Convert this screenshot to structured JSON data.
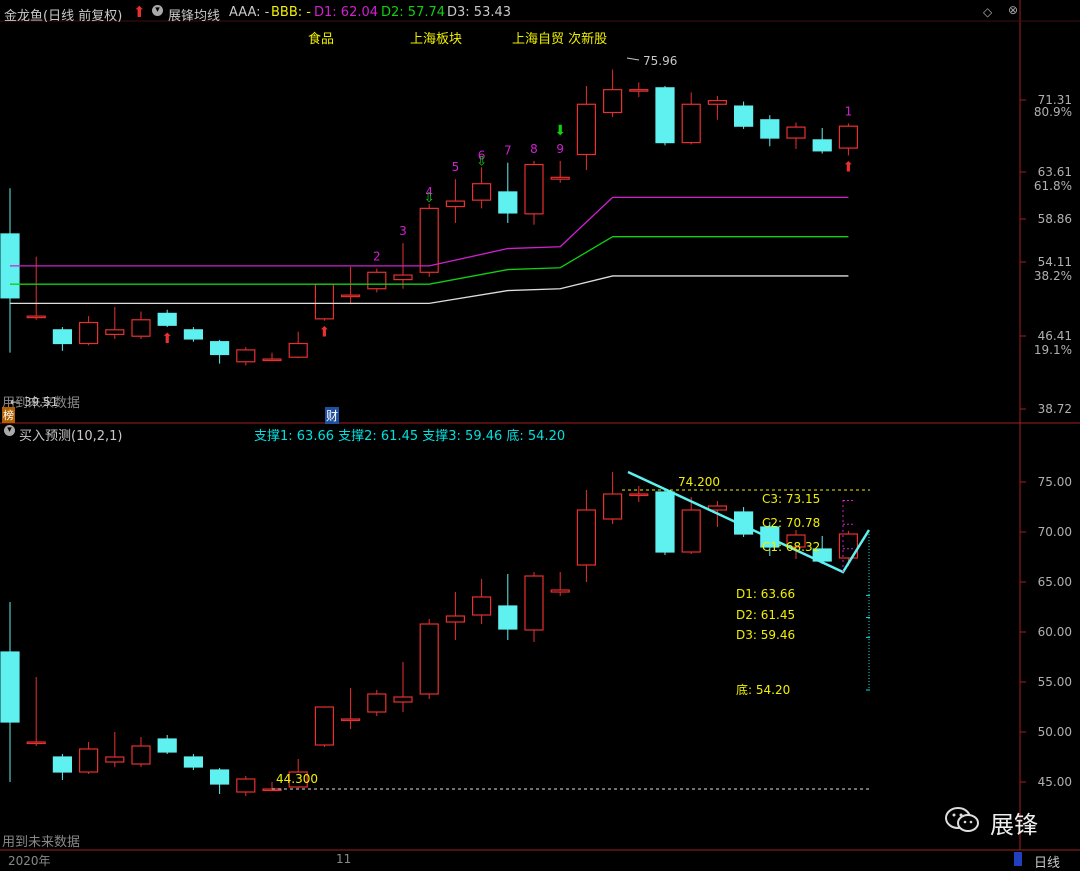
{
  "colors": {
    "up": "#e83030",
    "down": "#5ff0f0",
    "text": "#c8c8c8",
    "yellow": "#f0f000",
    "magenta": "#d020d0",
    "green": "#10d010",
    "white": "#dddddd",
    "cyan": "#00e0e0",
    "axis": "#b0b0b0",
    "red_axis": "#e83030"
  },
  "header": {
    "stock_name": "金龙鱼(日线 前复权)",
    "indicator": "展锋均线",
    "aaa": "AAA: -",
    "bbb": "BBB: -",
    "d1": "D1: 62.04",
    "d2": "D2: 57.74",
    "d3": "D3: 53.43"
  },
  "concepts": [
    "食品",
    "上海板块",
    "上海自贸 次新股"
  ],
  "sub_header": {
    "name": "买入预测(10,2,1)",
    "support_values": "支撑1: 63.66 支撑2: 61.45 支撑3: 59.46 底: 54.20"
  },
  "top_axis": [
    {
      "v": "71.31",
      "c": "price"
    },
    {
      "v": "80.9%",
      "c": "pct"
    },
    {
      "v": "63.61",
      "c": "price"
    },
    {
      "v": "61.8%",
      "c": "pct"
    },
    {
      "v": "58.86",
      "c": "price"
    },
    {
      "v": "54.11",
      "c": "price"
    },
    {
      "v": "38.2%",
      "c": "pct"
    },
    {
      "v": "46.41",
      "c": "price"
    },
    {
      "v": "19.1%",
      "c": "pct"
    },
    {
      "v": "38.72",
      "c": "price"
    }
  ],
  "bottom_axis": [
    "75.00",
    "70.00",
    "65.00",
    "60.00",
    "55.00",
    "50.00",
    "45.00"
  ],
  "labels": {
    "future_top": "用到未来数据",
    "future_bottom": "用到未来数据",
    "low_mark": "← 39.51",
    "high_mark": "75.96",
    "bang": "榜",
    "cai": "财",
    "hi_line": "74.200",
    "lo_line": "44.300",
    "c3": "C3: 73.15",
    "c2": "C2: 70.78",
    "c1": "C1: 68.32",
    "pd1": "D1: 63.66",
    "pd2": "D2: 61.45",
    "pd3": "D3: 59.46",
    "pdi": "底: 54.20",
    "count_labels": [
      "2",
      "3",
      "4",
      "5",
      "6",
      "7",
      "8",
      "9",
      "1"
    ],
    "year": "2020年",
    "month": "11",
    "period": "日线",
    "watermark": "展锋"
  },
  "chart_data": {
    "type": "candlestick",
    "candles": [
      {
        "o": 58.0,
        "h": 63.0,
        "l": 45.0,
        "c": 51.0
      },
      {
        "o": 49.0,
        "h": 55.5,
        "l": 48.6,
        "c": 49.0
      },
      {
        "o": 47.5,
        "h": 47.8,
        "l": 45.2,
        "c": 46.0
      },
      {
        "o": 46.0,
        "h": 49.0,
        "l": 45.8,
        "c": 48.3
      },
      {
        "o": 47.0,
        "h": 50.0,
        "l": 46.5,
        "c": 47.5
      },
      {
        "o": 46.8,
        "h": 49.5,
        "l": 46.5,
        "c": 48.6
      },
      {
        "o": 49.3,
        "h": 49.7,
        "l": 47.8,
        "c": 48.0
      },
      {
        "o": 47.5,
        "h": 47.8,
        "l": 46.2,
        "c": 46.5
      },
      {
        "o": 46.2,
        "h": 46.4,
        "l": 43.8,
        "c": 44.8
      },
      {
        "o": 44.0,
        "h": 45.6,
        "l": 43.6,
        "c": 45.3
      },
      {
        "o": 44.3,
        "h": 45.0,
        "l": 44.1,
        "c": 44.3
      },
      {
        "o": 44.5,
        "h": 47.3,
        "l": 44.4,
        "c": 46.0
      },
      {
        "o": 48.7,
        "h": 52.0,
        "l": 48.5,
        "c": 52.5
      },
      {
        "o": 51.3,
        "h": 54.4,
        "l": 50.3,
        "c": 51.3
      },
      {
        "o": 52.0,
        "h": 54.2,
        "l": 51.6,
        "c": 53.8
      },
      {
        "o": 53.0,
        "h": 57.0,
        "l": 52.0,
        "c": 53.5
      },
      {
        "o": 53.8,
        "h": 61.3,
        "l": 53.3,
        "c": 60.8
      },
      {
        "o": 61.0,
        "h": 64.0,
        "l": 59.2,
        "c": 61.6
      },
      {
        "o": 61.7,
        "h": 65.3,
        "l": 60.8,
        "c": 63.5
      },
      {
        "o": 62.6,
        "h": 65.8,
        "l": 59.2,
        "c": 60.3
      },
      {
        "o": 60.2,
        "h": 66.0,
        "l": 59.0,
        "c": 65.6
      },
      {
        "o": 64.0,
        "h": 66.0,
        "l": 63.6,
        "c": 64.2
      },
      {
        "o": 66.7,
        "h": 74.2,
        "l": 65.0,
        "c": 72.2
      },
      {
        "o": 71.3,
        "h": 76.0,
        "l": 70.8,
        "c": 73.8
      },
      {
        "o": 73.8,
        "h": 74.6,
        "l": 73.0,
        "c": 73.8
      },
      {
        "o": 74.0,
        "h": 74.2,
        "l": 67.7,
        "c": 68.0
      },
      {
        "o": 68.0,
        "h": 73.5,
        "l": 67.8,
        "c": 72.2
      },
      {
        "o": 72.2,
        "h": 73.1,
        "l": 70.5,
        "c": 72.6
      },
      {
        "o": 72.0,
        "h": 72.5,
        "l": 69.5,
        "c": 69.8
      },
      {
        "o": 70.5,
        "h": 71.0,
        "l": 67.6,
        "c": 68.5
      },
      {
        "o": 68.5,
        "h": 70.2,
        "l": 67.3,
        "c": 69.7
      },
      {
        "o": 68.3,
        "h": 69.6,
        "l": 66.8,
        "c": 67.1
      },
      {
        "o": 67.4,
        "h": 70.1,
        "l": 66.6,
        "c": 69.8
      }
    ],
    "ma_magenta": [
      {
        "i": 0,
        "v": 54.5
      },
      {
        "i": 16,
        "v": 54.5
      },
      {
        "i": 19,
        "v": 56.4
      },
      {
        "i": 21,
        "v": 56.6
      },
      {
        "i": 23,
        "v": 62.0
      },
      {
        "i": 32,
        "v": 62.0
      }
    ],
    "ma_green": [
      {
        "i": 0,
        "v": 52.5
      },
      {
        "i": 16,
        "v": 52.5
      },
      {
        "i": 19,
        "v": 54.1
      },
      {
        "i": 21,
        "v": 54.3
      },
      {
        "i": 23,
        "v": 57.7
      },
      {
        "i": 32,
        "v": 57.7
      }
    ],
    "ma_white": [
      {
        "i": 0,
        "v": 50.4
      },
      {
        "i": 16,
        "v": 50.4
      },
      {
        "i": 19,
        "v": 51.8
      },
      {
        "i": 21,
        "v": 52.0
      },
      {
        "i": 23,
        "v": 53.4
      },
      {
        "i": 32,
        "v": 53.4
      }
    ],
    "top_ylim": [
      38.72,
      76.5
    ],
    "bottom_ylim": [
      41.0,
      78.0
    ]
  }
}
